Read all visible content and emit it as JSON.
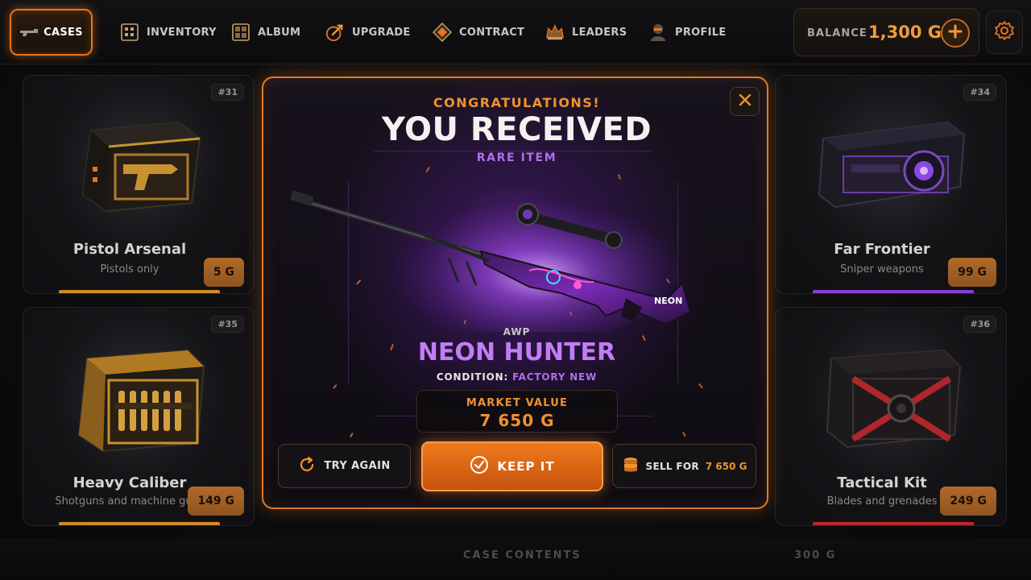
{
  "nav": {
    "cases": "CASES",
    "items": [
      {
        "label": "INVENTORY",
        "icon": "inventory-icon"
      },
      {
        "label": "ALBUM",
        "icon": "album-icon"
      },
      {
        "label": "UPGRADE",
        "icon": "upgrade-icon"
      },
      {
        "label": "CONTRACT",
        "icon": "contract-icon"
      },
      {
        "label": "LEADERS",
        "icon": "leaders-icon"
      },
      {
        "label": "PROFILE",
        "icon": "profile-icon"
      }
    ]
  },
  "balance": {
    "label": "BALANCE",
    "amount": "1,300 G"
  },
  "cases": [
    {
      "num": "#31",
      "name": "Pistol Arsenal",
      "sub": "Pistols only",
      "price": "5 G",
      "accent": "#d08a2a"
    },
    {
      "num": "#35",
      "name": "Heavy Caliber",
      "sub": "Shotguns and machine guns",
      "price": "149 G",
      "accent": "#d08a2a"
    },
    {
      "num": "#34",
      "name": "Far Frontier",
      "sub": "Sniper weapons",
      "price": "99 G",
      "accent": "#8a3ed0"
    },
    {
      "num": "#36",
      "name": "Tactical Kit",
      "sub": "Blades and grenades",
      "price": "249 G",
      "accent": "#c0282a"
    }
  ],
  "modal": {
    "congrats": "CONGRATULATIONS!",
    "title": "YOU RECEIVED",
    "rarity": "RARE ITEM",
    "weapon_type": "AWP",
    "weapon_name": "NEON HUNTER",
    "condition_label": "CONDITION:",
    "condition_value": "FACTORY NEW",
    "market_label": "MARKET VALUE",
    "market_value": "7 650 G",
    "skin_tag": "NEON",
    "try_again": "TRY AGAIN",
    "keep": "KEEP IT",
    "sell_label": "SELL FOR",
    "sell_amount": "7 650 G"
  },
  "bottom": {
    "contents": "CASE CONTENTS",
    "price": "300 G"
  },
  "colors": {
    "accent": "#e8741c",
    "rare": "#b36cf0",
    "gold": "#f0922e"
  }
}
